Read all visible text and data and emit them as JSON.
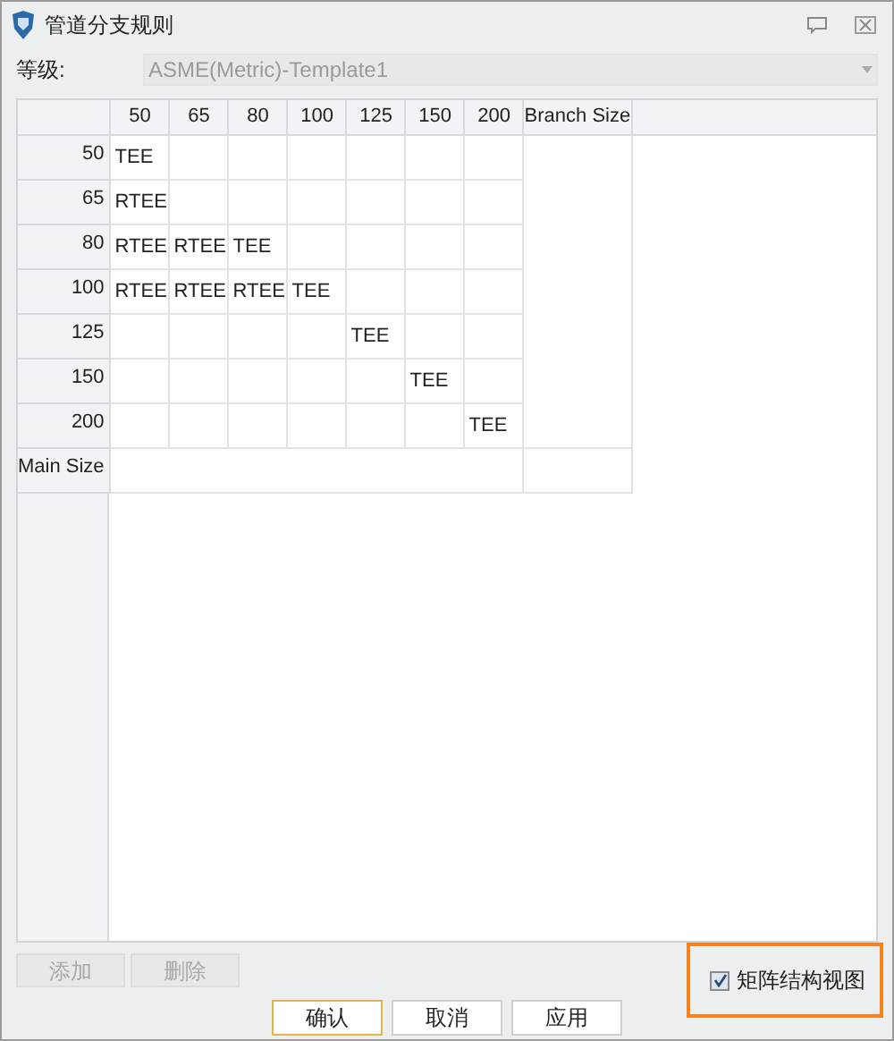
{
  "window": {
    "title": "管道分支规则"
  },
  "grade": {
    "label": "等级:",
    "value": "ASME(Metric)-Template1",
    "disabled": true
  },
  "table": {
    "columns": [
      "50",
      "65",
      "80",
      "100",
      "125",
      "150",
      "200"
    ],
    "branch_header": "Branch Size",
    "rows": [
      {
        "header": "50",
        "cells": [
          "TEE",
          null,
          null,
          null,
          null,
          null,
          null
        ]
      },
      {
        "header": "65",
        "cells": [
          "RTEE",
          null,
          null,
          null,
          null,
          null,
          null
        ]
      },
      {
        "header": "80",
        "cells": [
          "RTEE",
          "RTEE",
          "TEE",
          null,
          null,
          null,
          null
        ]
      },
      {
        "header": "100",
        "cells": [
          "RTEE",
          "RTEE",
          "RTEE",
          "TEE",
          null,
          null,
          null
        ]
      },
      {
        "header": "125",
        "cells": [
          null,
          null,
          null,
          null,
          "TEE",
          null,
          null
        ]
      },
      {
        "header": "150",
        "cells": [
          null,
          null,
          null,
          null,
          null,
          "TEE",
          null
        ]
      },
      {
        "header": "200",
        "cells": [
          null,
          null,
          null,
          null,
          null,
          null,
          "TEE"
        ]
      }
    ],
    "footer_header": "Main Size"
  },
  "row_buttons": [
    {
      "label": "添加",
      "disabled": true
    },
    {
      "label": "删除",
      "disabled": true
    }
  ],
  "matrix_view": {
    "label": "矩阵结构视图",
    "checked": true
  },
  "buttons": [
    {
      "label": "确认",
      "default": true
    },
    {
      "label": "取消",
      "default": false
    },
    {
      "label": "应用",
      "default": false
    }
  ]
}
